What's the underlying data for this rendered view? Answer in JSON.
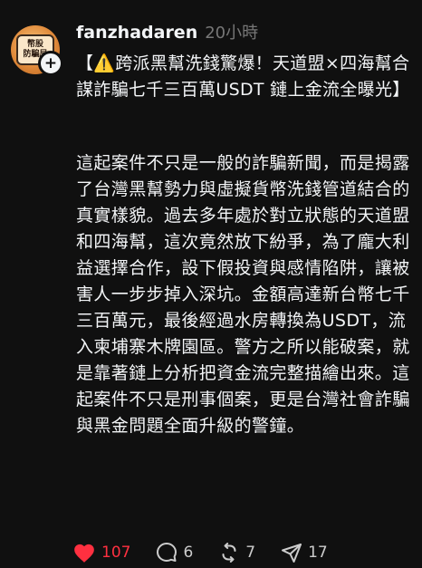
{
  "post": {
    "username": "fanzhadaren",
    "timestamp": "20小時",
    "avatar_badge_line1": "幣股",
    "avatar_badge_line2": "防騙局",
    "title": "【⚠️跨派黑幫洗錢驚爆！天道盟×四海幫合謀詐騙七千三百萬USDT 鏈上金流全曝光】",
    "body": "這起案件不只是一般的詐騙新聞，而是揭露了台灣黑幫勢力與虛擬貨幣洗錢管道結合的真實樣貌。過去多年處於對立狀態的天道盟和四海幫，這次竟然放下紛爭，為了龐大利益選擇合作，設下假投資與感情陷阱，讓被害人一步步掉入深坑。金額高達新台幣七千三百萬元，最後經過水房轉換為USDT，流入柬埔寨木牌園區。警方之所以能破案，就是靠著鏈上分析把資金流完整描繪出來。這起案件不只是刑事個案，更是台灣社會詐騙與黑金問題全面升級的警鐘。"
  },
  "actions": {
    "likes": "107",
    "comments": "6",
    "reposts": "7",
    "shares": "17"
  },
  "colors": {
    "background": "#101010",
    "text": "#f3f5f7",
    "muted": "#777777",
    "like": "#ff3040"
  }
}
